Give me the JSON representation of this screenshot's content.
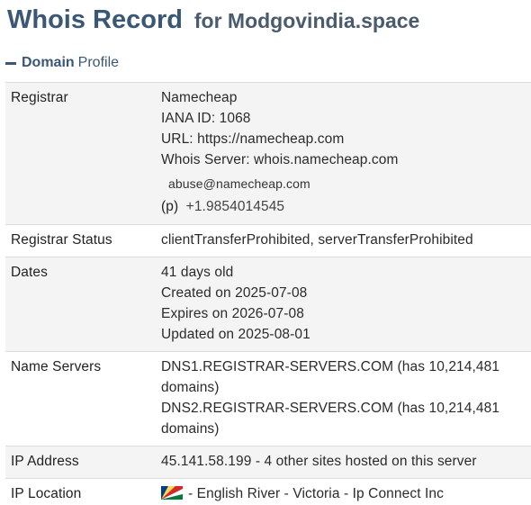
{
  "header": {
    "title": "Whois Record",
    "subtitle": "for Modgovindia.space"
  },
  "section": {
    "label_strong": "Domain",
    "label_light": "Profile"
  },
  "rows": {
    "registrar": {
      "label": "Registrar",
      "name": "Namecheap",
      "iana": "IANA ID: 1068",
      "url": "URL: https://namecheap.com",
      "whois_server": "Whois Server: whois.namecheap.com",
      "abuse_email": "abuse@namecheap.com",
      "phone_tag": "(p)",
      "phone": "+1.9854014545"
    },
    "registrar_status": {
      "label": "Registrar Status",
      "value": "clientTransferProhibited, serverTransferProhibited"
    },
    "dates": {
      "label": "Dates",
      "age": "41 days old",
      "created": "Created on 2025-07-08",
      "expires": "Expires on 2026-07-08",
      "updated": "Updated on 2025-08-01"
    },
    "name_servers": {
      "label": "Name Servers",
      "ns1": "DNS1.REGISTRAR-SERVERS.COM (has 10,214,481 domains)",
      "ns2": "DNS2.REGISTRAR-SERVERS.COM (has 10,214,481 domains)"
    },
    "ip_address": {
      "label": "IP Address",
      "value": "45.141.58.199 - 4 other sites hosted on this server"
    },
    "ip_location": {
      "label": "IP Location",
      "flag_icon": "seychelles-flag-icon",
      "value": "- English River - Victoria - Ip Connect Inc"
    }
  }
}
